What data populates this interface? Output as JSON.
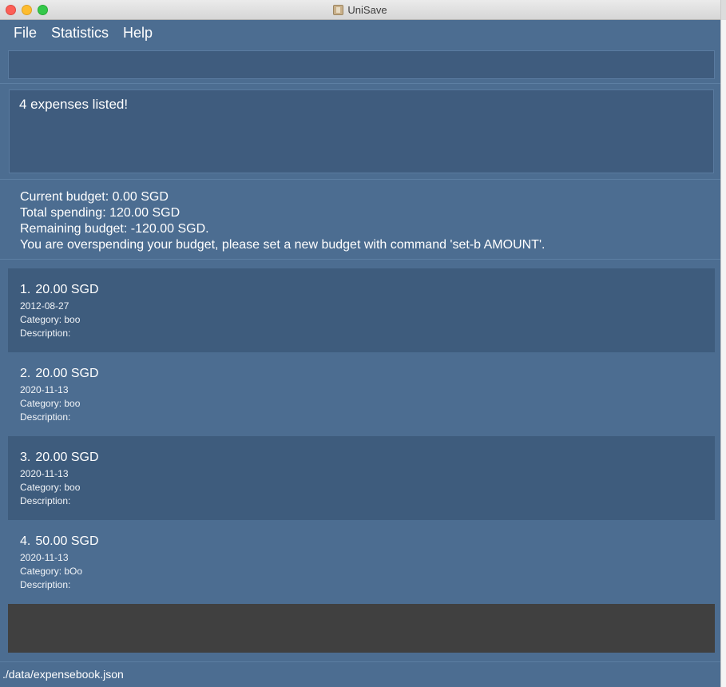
{
  "window": {
    "title": "UniSave"
  },
  "menu": [
    "File",
    "Statistics",
    "Help"
  ],
  "command_box": {
    "value": ""
  },
  "result": {
    "text": "4 expenses listed!"
  },
  "budget": {
    "current": "Current budget: 0.00 SGD",
    "total": "Total spending: 120.00 SGD",
    "remaining": "Remaining budget: -120.00 SGD.",
    "warning": "You are overspending your budget, please set a new budget with command 'set-b AMOUNT'."
  },
  "expenses": [
    {
      "index": "1.",
      "amount": "20.00 SGD",
      "date": "2012-08-27",
      "category": "Category: boo",
      "description": "Description:"
    },
    {
      "index": "2.",
      "amount": "20.00 SGD",
      "date": "2020-11-13",
      "category": "Category: boo",
      "description": "Description:"
    },
    {
      "index": "3.",
      "amount": "20.00 SGD",
      "date": "2020-11-13",
      "category": "Category: boo",
      "description": "Description:"
    },
    {
      "index": "4.",
      "amount": "50.00 SGD",
      "date": "2020-11-13",
      "category": "Category: bOo",
      "description": "Description:"
    }
  ],
  "status_bar": {
    "path": "./data/expensebook.json"
  },
  "colors": {
    "background": "#4c6d91",
    "panel": "#3f5c7e",
    "card_dark": "#3e5c7d",
    "bottom_panel": "#404040"
  }
}
